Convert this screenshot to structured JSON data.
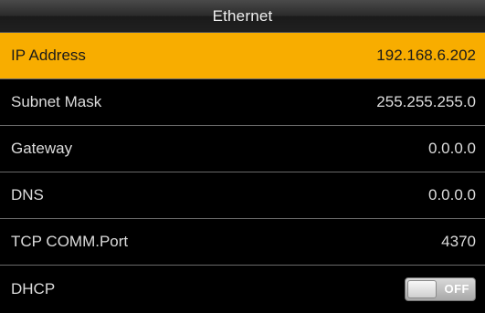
{
  "header": {
    "title": "Ethernet"
  },
  "rows": [
    {
      "label": "IP Address",
      "value": "192.168.6.202",
      "selected": true
    },
    {
      "label": "Subnet Mask",
      "value": "255.255.255.0"
    },
    {
      "label": "Gateway",
      "value": "0.0.0.0"
    },
    {
      "label": "DNS",
      "value": "0.0.0.0"
    },
    {
      "label": "TCP COMM.Port",
      "value": "4370"
    },
    {
      "label": "DHCP",
      "toggle_text": "OFF",
      "toggle_on": false
    }
  ],
  "colors": {
    "selected_row": "#f8ad00",
    "background": "#000000"
  }
}
